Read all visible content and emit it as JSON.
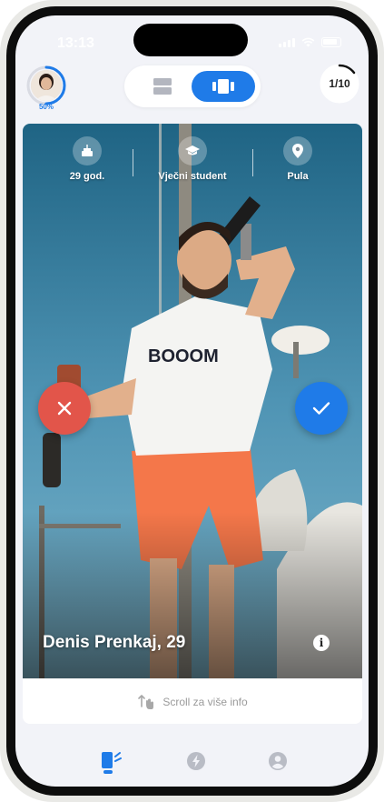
{
  "status_bar": {
    "time": "13:13"
  },
  "header": {
    "profile_completion": "50%",
    "counter": "1/10",
    "view_mode": "card"
  },
  "profile": {
    "name": "Denis Prenkaj, 29",
    "info": [
      {
        "icon": "cake-icon",
        "label": "29 god."
      },
      {
        "icon": "graduation-cap-icon",
        "label": "Vječni student"
      },
      {
        "icon": "location-pin-icon",
        "label": "Pula"
      }
    ]
  },
  "scroll_hint": {
    "label": "Scroll za više info"
  },
  "tabs": [
    {
      "name": "swipe-tab",
      "active": true
    },
    {
      "name": "boost-tab",
      "active": false
    },
    {
      "name": "profile-tab",
      "active": false
    }
  ],
  "colors": {
    "accent": "#1f7be8",
    "dislike": "#e2554a",
    "background": "#f2f3f8"
  }
}
